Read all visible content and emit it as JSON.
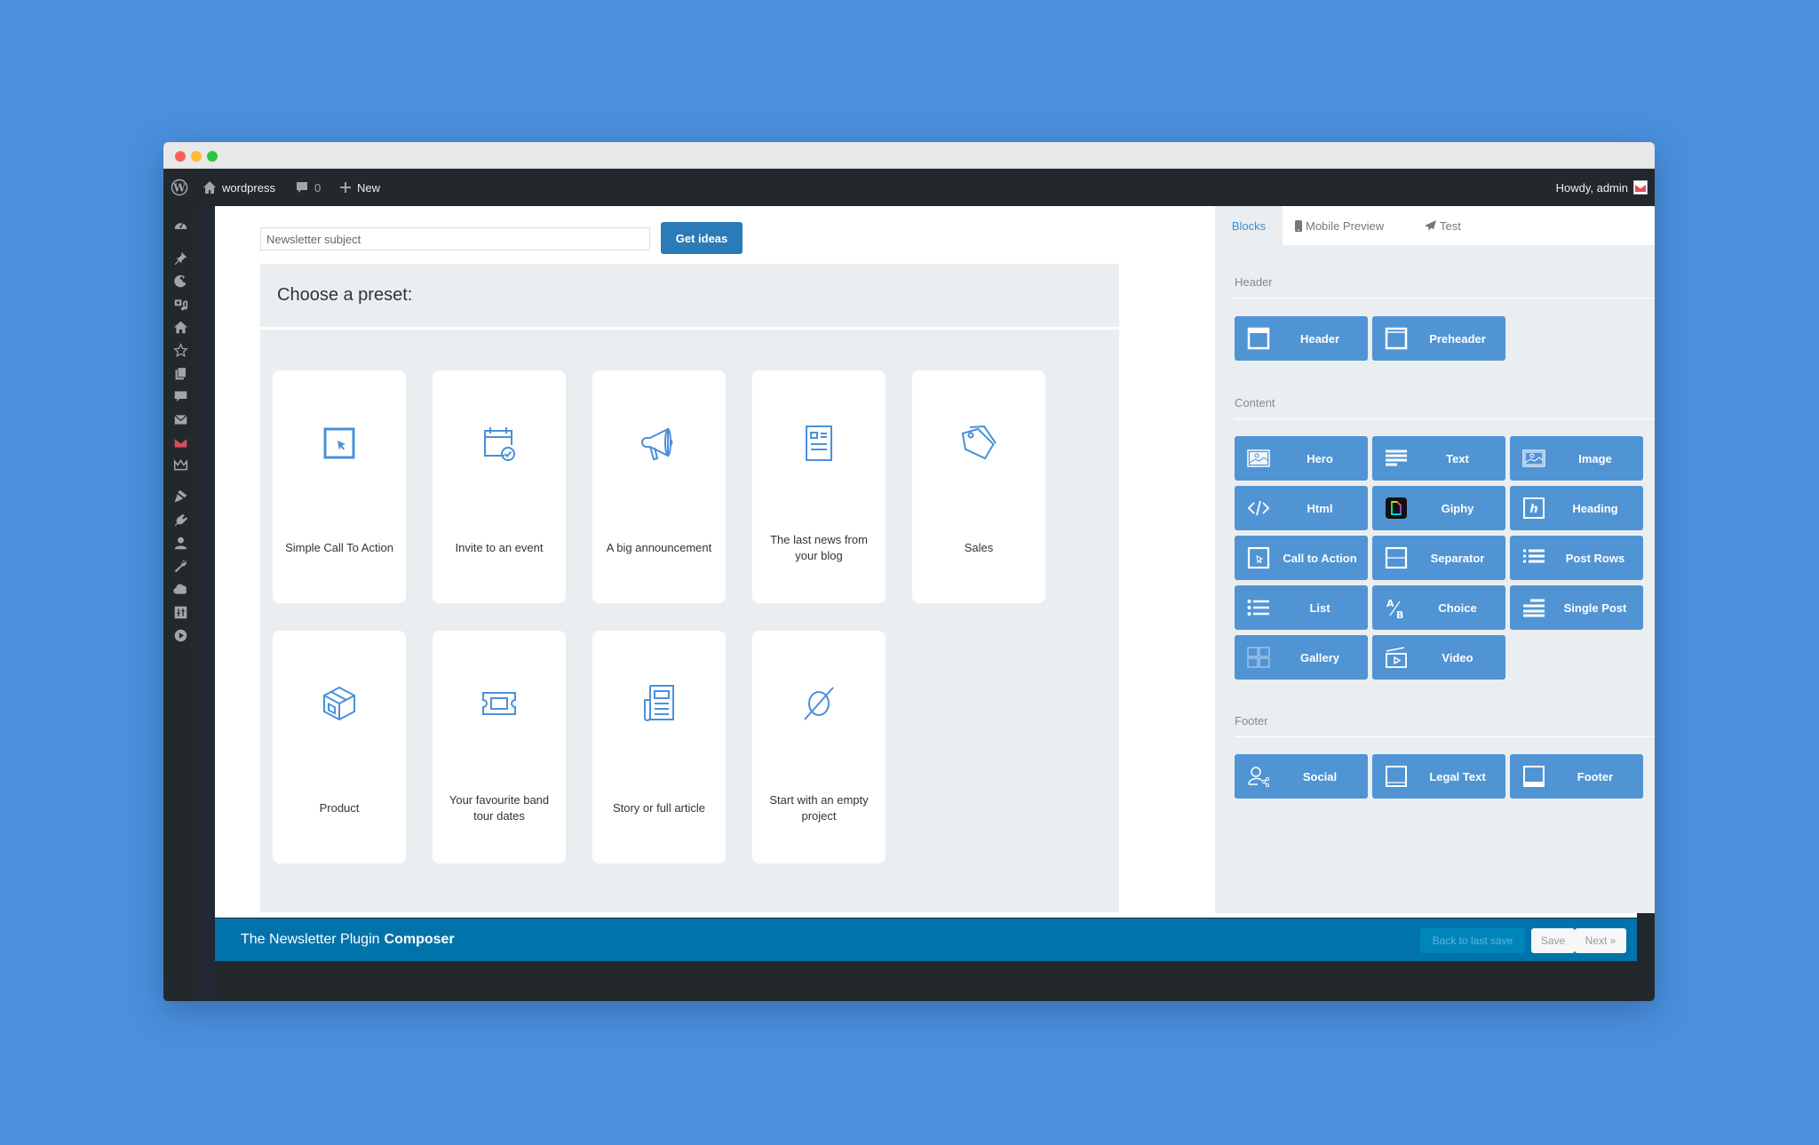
{
  "admin_bar": {
    "site_name": "wordpress",
    "comments_count": "0",
    "new_label": "New",
    "howdy": "Howdy, admin"
  },
  "sidebar": {
    "icons": [
      "dashboard-icon",
      "pin-icon",
      "palette-icon",
      "media-icon",
      "home-icon",
      "star-icon",
      "pages-icon",
      "comment-icon",
      "mail-icon",
      "newsletter-icon",
      "crown-icon",
      "brush-icon",
      "plugin-icon",
      "user-icon",
      "wrench-icon",
      "cloud-icon",
      "settings-sliders-icon",
      "play-icon"
    ]
  },
  "composer": {
    "subject_placeholder": "Newsletter subject",
    "get_ideas_label": "Get ideas",
    "preset_heading": "Choose a preset:",
    "presets": [
      {
        "label": "Simple Call To Action",
        "icon": "cursor-box-icon"
      },
      {
        "label": "Invite to an event",
        "icon": "calendar-check-icon"
      },
      {
        "label": "A big announcement",
        "icon": "megaphone-icon"
      },
      {
        "label": "The last news from your blog",
        "icon": "document-icon"
      },
      {
        "label": "Sales",
        "icon": "tag-icon"
      },
      {
        "label": "Product",
        "icon": "box-icon"
      },
      {
        "label": "Your favourite band tour dates",
        "icon": "ticket-icon"
      },
      {
        "label": "Story or full article",
        "icon": "newspaper-icon"
      },
      {
        "label": "Start with an empty project",
        "icon": "empty-set-icon"
      }
    ]
  },
  "right_panel": {
    "tabs": [
      {
        "label": "Blocks",
        "active": true
      },
      {
        "label": "Mobile Preview",
        "active": false
      },
      {
        "label": "Test",
        "active": false
      }
    ],
    "sections": [
      {
        "title": "Header",
        "blocks": [
          {
            "label": "Header",
            "icon": "header-block-icon"
          },
          {
            "label": "Preheader",
            "icon": "preheader-block-icon"
          }
        ]
      },
      {
        "title": "Content",
        "blocks": [
          {
            "label": "Hero",
            "icon": "hero-image-icon"
          },
          {
            "label": "Text",
            "icon": "text-lines-icon"
          },
          {
            "label": "Image",
            "icon": "image-icon"
          },
          {
            "label": "Html",
            "icon": "code-icon"
          },
          {
            "label": "Giphy",
            "icon": "giphy-icon"
          },
          {
            "label": "Heading",
            "icon": "heading-icon"
          },
          {
            "label": "Call to Action",
            "icon": "cta-cursor-icon"
          },
          {
            "label": "Separator",
            "icon": "separator-icon"
          },
          {
            "label": "Post Rows",
            "icon": "post-rows-icon"
          },
          {
            "label": "List",
            "icon": "list-icon"
          },
          {
            "label": "Choice",
            "icon": "ab-choice-icon"
          },
          {
            "label": "Single Post",
            "icon": "single-post-icon"
          },
          {
            "label": "Gallery",
            "icon": "gallery-icon"
          },
          {
            "label": "Video",
            "icon": "video-icon"
          }
        ]
      },
      {
        "title": "Footer",
        "blocks": [
          {
            "label": "Social",
            "icon": "social-user-share-icon"
          },
          {
            "label": "Legal Text",
            "icon": "legal-text-icon"
          },
          {
            "label": "Footer",
            "icon": "footer-block-icon"
          }
        ]
      }
    ]
  },
  "footer": {
    "title_regular": "The Newsletter Plugin",
    "title_bold": "Composer",
    "back_label": "Back to last save",
    "save_label": "Save",
    "next_label": "Next »"
  },
  "colors": {
    "background": "#4a90df",
    "wp_dark": "#23282d",
    "accent_blue": "#2b7bb9",
    "block_blue": "#5094d4",
    "footer_blue": "#0073aa",
    "panel_gray": "#ebeef0",
    "icon_blue": "#4a90d9"
  }
}
